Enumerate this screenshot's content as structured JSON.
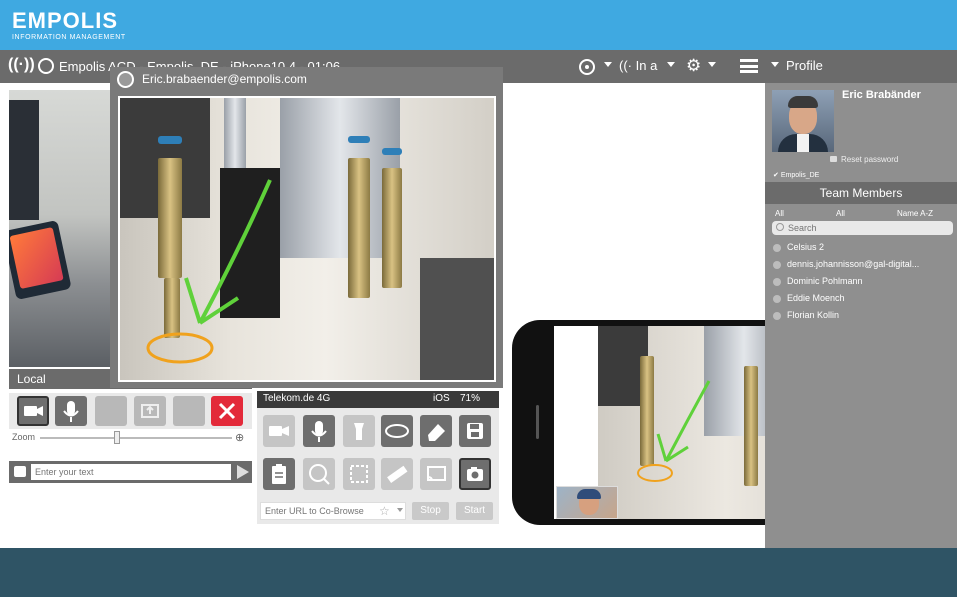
{
  "brand": {
    "name": "EMPOLIS",
    "subtitle": "INFORMATION MANAGEMENT"
  },
  "toolbar": {
    "session_title": "Empolis ACD - Empolis_DE - iPhone10,4 - 01:06",
    "audio_label": "In a",
    "profile_label": "Profile"
  },
  "remote": {
    "email": "Eric.brabaender@empolis.com"
  },
  "local": {
    "label": "Local",
    "zoom_label": "Zoom",
    "chat_placeholder": "Enter your text"
  },
  "cobrowse": {
    "carrier": "Telekom.de",
    "network": "4G",
    "os": "iOS",
    "battery": "71%",
    "url_placeholder": "Enter URL to Co-Browse",
    "stop_label": "Stop",
    "start_label": "Start"
  },
  "profile": {
    "name": "Eric Brabänder",
    "reset_password": "Reset password",
    "tenant": "Empolis_DE",
    "team_header": "Team Members",
    "filters": [
      "All",
      "All",
      "Name A-Z"
    ],
    "search_placeholder": "Search",
    "members": [
      "Celsius 2",
      "dennis.johannisson@gal-digital...",
      "Dominic Pohlmann",
      "Eddie Moench",
      "Florian Kollin"
    ]
  },
  "colors": {
    "brand_blue": "#3fa9e1",
    "toolbar_gray": "#6b6b6b",
    "footer": "#2f5465",
    "end_call_red": "#e32a3a",
    "annotation_green": "#5fd13a",
    "annotation_orange": "#f0a21d"
  },
  "icons": {
    "toolbar": [
      "call-icon",
      "user-icon",
      "crosshair-icon",
      "speaker-icon",
      "gear-icon",
      "hamburger-icon"
    ],
    "local_controls": [
      "camera-icon",
      "microphone-icon",
      "blank",
      "screen-share-icon",
      "blank",
      "close-icon"
    ],
    "cobrowse_row1": [
      "video-icon",
      "microphone-icon",
      "flashlight-icon",
      "ellipse-icon",
      "eraser-icon",
      "save-icon"
    ],
    "cobrowse_row2": [
      "clipboard-icon",
      "zoom-text-icon",
      "text-select-icon",
      "ruler-icon",
      "cast-icon",
      "camera-icon"
    ]
  }
}
